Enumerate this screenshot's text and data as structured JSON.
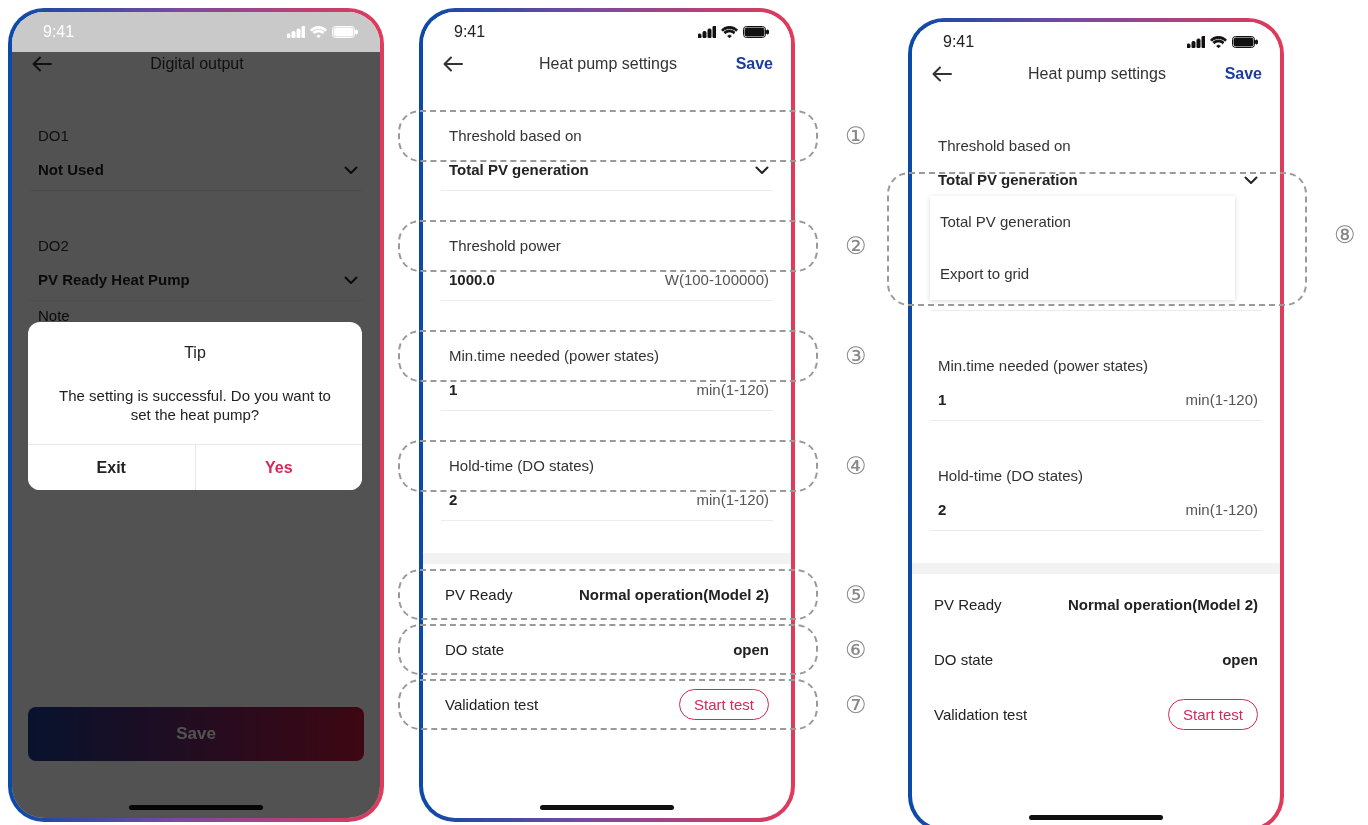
{
  "phones": [
    {
      "time": "9:41",
      "title": "Digital output",
      "dimmed": true,
      "fields": [
        {
          "label": "DO1",
          "value": "Not Used",
          "kind": "select"
        },
        {
          "label": "DO2",
          "value": "PV Ready Heat Pump",
          "kind": "select"
        }
      ],
      "note": "Note",
      "dialog": {
        "title": "Tip",
        "message": "The setting is successful. Do you want to set the heat pump?",
        "buttons": [
          {
            "label": "Exit",
            "kind": "cancel"
          },
          {
            "label": "Yes",
            "kind": "confirm"
          }
        ]
      },
      "bottom_button": "Save"
    },
    {
      "time": "9:41",
      "title": "Heat pump settings",
      "dimmed": false,
      "action": "Save",
      "fields": [
        {
          "label": "Threshold based on",
          "value": "Total PV generation",
          "kind": "select",
          "label_callout": "①"
        },
        {
          "label": "Threshold power",
          "value": "1000.0",
          "unit": "W(100-100000)",
          "kind": "input",
          "label_callout": "②"
        },
        {
          "label": "Min.time needed (power states)",
          "value": "1",
          "unit": "min(1-120)",
          "kind": "input",
          "label_callout": "③"
        },
        {
          "label": "Hold-time (DO states)",
          "value": "2",
          "unit": "min(1-120)",
          "kind": "input",
          "label_callout": "④"
        }
      ],
      "info_rows": [
        {
          "label": "PV Ready",
          "value": "Normal operation(Model 2)",
          "kind": "text",
          "callout": "⑤"
        },
        {
          "label": "DO state",
          "value": "open",
          "kind": "text",
          "callout": "⑥"
        },
        {
          "label": "Validation test",
          "value": "Start test",
          "kind": "button",
          "callout": "⑦"
        }
      ]
    },
    {
      "time": "9:41",
      "title": "Heat pump settings",
      "dimmed": false,
      "action": "Save",
      "fields": [
        {
          "label": "Threshold based on",
          "value": "Total PV generation",
          "kind": "select",
          "options": [
            "Total PV generation",
            "Export to grid"
          ],
          "value_callout": "⑧"
        },
        {
          "label": "Min.time needed (power states)",
          "value": "1",
          "unit": "min(1-120)",
          "kind": "input"
        },
        {
          "label": "Hold-time (DO states)",
          "value": "2",
          "unit": "min(1-120)",
          "kind": "input"
        }
      ],
      "info_rows": [
        {
          "label": "PV Ready",
          "value": "Normal operation(Model 2)",
          "kind": "text"
        },
        {
          "label": "DO state",
          "value": "open",
          "kind": "text"
        },
        {
          "label": "Validation test",
          "value": "Start test",
          "kind": "button"
        }
      ]
    }
  ]
}
